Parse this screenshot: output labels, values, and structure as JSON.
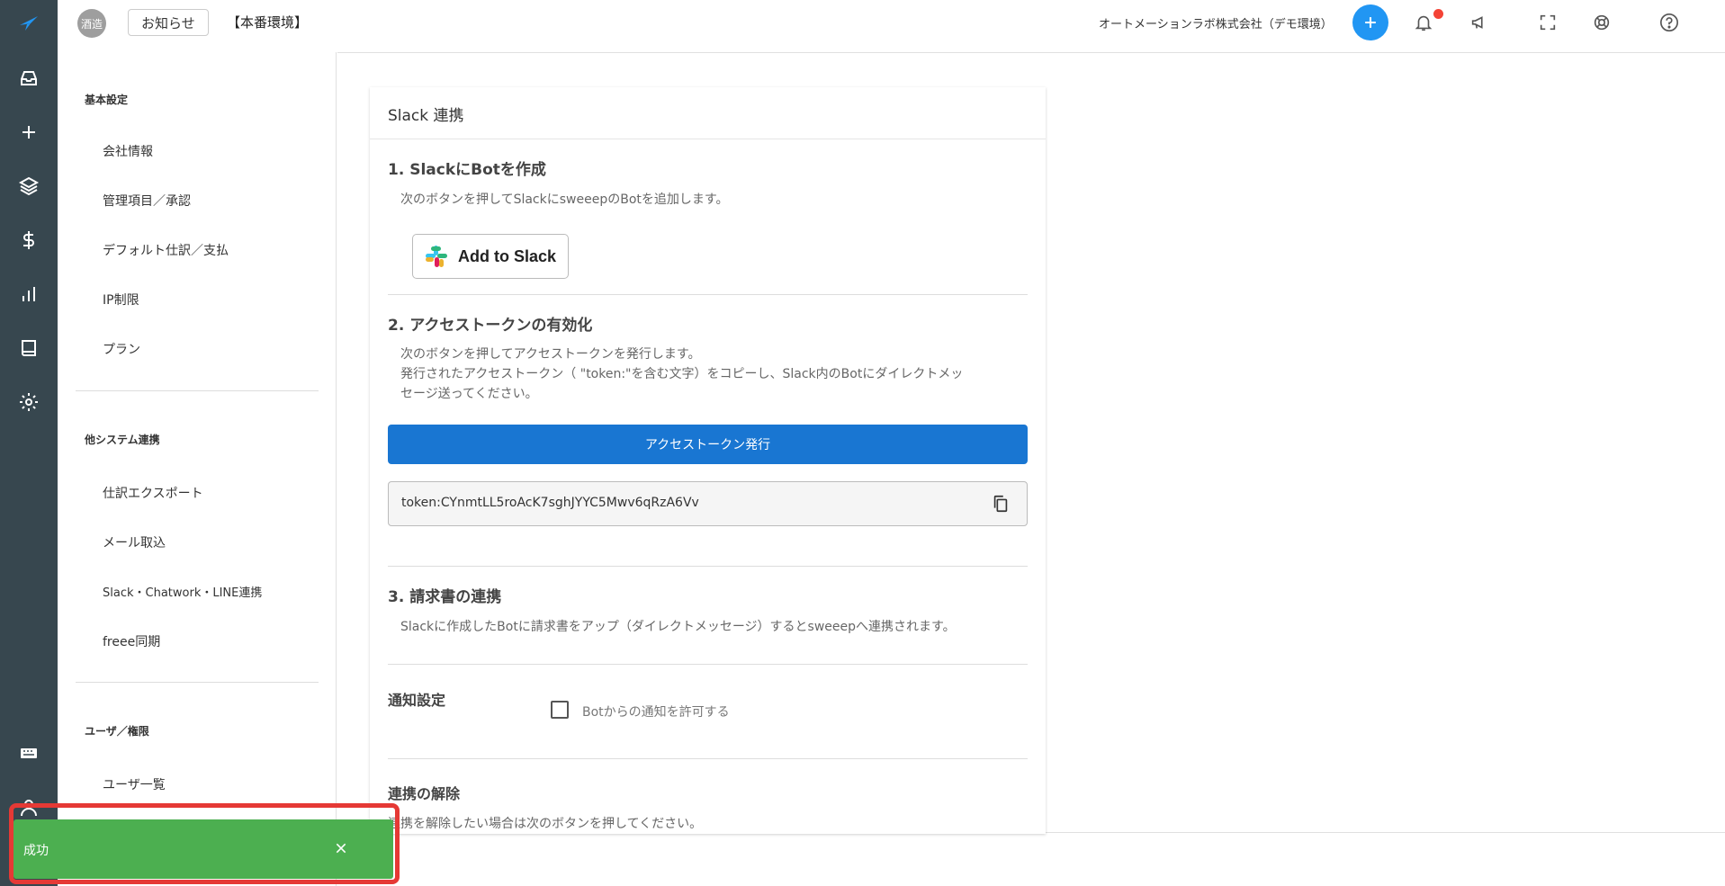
{
  "topbar": {
    "env_badge": "酒造",
    "notice_button": "お知らせ",
    "env_label": "【本番環境】",
    "company_name": "オートメーションラボ株式会社（デモ環境）"
  },
  "settings_nav": {
    "sections": [
      {
        "title": "基本設定",
        "items": [
          "会社情報",
          "管理項目／承認",
          "デフォルト仕訳／支払",
          "IP制限",
          "プラン"
        ]
      },
      {
        "title": "他システム連携",
        "items": [
          "仕訳エクスポート",
          "メール取込",
          "Slack・Chatwork・LINE連携",
          "freee同期"
        ]
      },
      {
        "title": "ユーザ／権限",
        "items": [
          "ユーザ一覧"
        ]
      }
    ]
  },
  "card": {
    "title": "Slack 連携",
    "step1": {
      "heading": "1. SlackにBotを作成",
      "description": "次のボタンを押してSlackにsweeepのBotを追加します。",
      "button": "Add to Slack"
    },
    "step2": {
      "heading": "2. アクセストークンの有効化",
      "line1": "次のボタンを押してアクセストークンを発行します。",
      "line2": "発行されたアクセストークン（ \"token:\"を含む文字）をコピーし、Slack内のBotにダイレクトメッ",
      "line3": "セージ送ってください。",
      "button": "アクセストークン発行",
      "token": "token:CYnmtLL5roAcK7sghJYYC5Mwv6qRzA6Vv"
    },
    "step3": {
      "heading": "3. 請求書の連携",
      "description": "Slackに作成したBotに請求書をアップ（ダイレクトメッセージ）するとsweeepへ連携されます。"
    },
    "notify": {
      "heading": "通知設定",
      "checkbox_label": "Botからの通知を許可する",
      "checked": false
    },
    "unlink": {
      "heading": "連携の解除",
      "description": "連携を解除したい場合は次のボタンを押してください。"
    }
  },
  "toast": {
    "message": "成功",
    "color": "#4caf50"
  },
  "colors": {
    "rail": "#37474f",
    "primary": "#1976d2",
    "accent": "#2196f3",
    "alert": "#f44336"
  }
}
